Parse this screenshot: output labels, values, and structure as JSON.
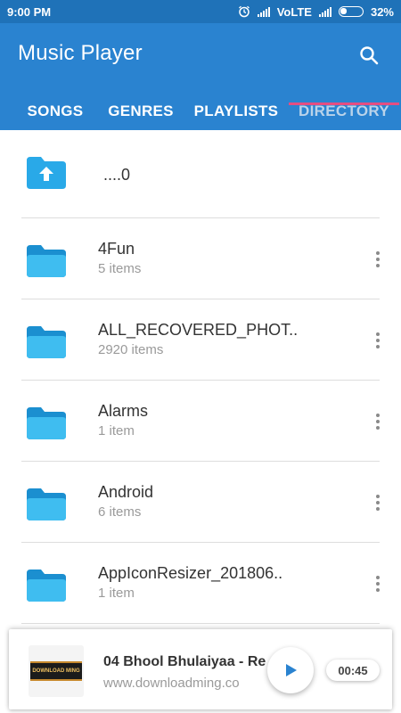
{
  "status_bar": {
    "time": "9:00 PM",
    "network": "VoLTE",
    "battery": "32%",
    "battery_level": 0.32
  },
  "app": {
    "title": "Music Player"
  },
  "tabs": [
    {
      "label": "SONGS",
      "active": false
    },
    {
      "label": "GENRES",
      "active": false
    },
    {
      "label": "PLAYLISTS",
      "active": false
    },
    {
      "label": "DIRECTORY",
      "active": true
    }
  ],
  "up_entry": {
    "label": "....0",
    "icon": "folder-up-icon"
  },
  "folders": [
    {
      "name": "4Fun",
      "count": "5 items"
    },
    {
      "name": "ALL_RECOVERED_PHOT..",
      "count": "2920 items"
    },
    {
      "name": "Alarms",
      "count": "1 item"
    },
    {
      "name": "Android",
      "count": "6 items"
    },
    {
      "name": "AppIconResizer_201806..",
      "count": "1 item"
    }
  ],
  "now_playing": {
    "title": "04 Bhool Bhulaiyaa - Re",
    "subtitle": "www.downloadming.co",
    "art_text": "DOWNLOAD MING",
    "time": "00:45"
  },
  "colors": {
    "status_bar": "#1f72b8",
    "app_bar": "#2a83d0",
    "tab_indicator": "#e44d82",
    "folder": "#29a9e8"
  }
}
